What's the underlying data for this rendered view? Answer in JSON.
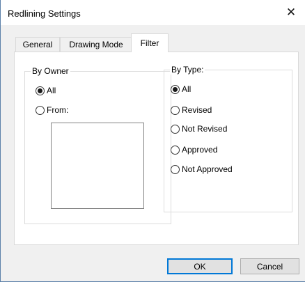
{
  "window": {
    "title": "Redlining Settings",
    "close_glyph": "✕"
  },
  "tabs": [
    {
      "label": "General",
      "active": false
    },
    {
      "label": "Drawing Mode",
      "active": false
    },
    {
      "label": "Filter",
      "active": true
    }
  ],
  "filter": {
    "by_owner": {
      "legend": "By Owner",
      "options": [
        {
          "label": "All",
          "selected": true
        },
        {
          "label": "From:",
          "selected": false
        }
      ],
      "owner_list_items": []
    },
    "by_type": {
      "legend": "By Type:",
      "options": [
        {
          "label": "All",
          "selected": true
        },
        {
          "label": "Revised",
          "selected": false
        },
        {
          "label": "Not Revised",
          "selected": false
        },
        {
          "label": "Approved",
          "selected": false
        },
        {
          "label": "Not Approved",
          "selected": false
        }
      ]
    }
  },
  "buttons": {
    "ok": "OK",
    "cancel": "Cancel"
  },
  "colors": {
    "default_button_border": "#0078d7",
    "window_border": "#5a7fa8"
  },
  "icons": {
    "close": "close-icon",
    "radio_selected": "radio-selected-icon",
    "radio_unselected": "radio-unselected-icon"
  }
}
